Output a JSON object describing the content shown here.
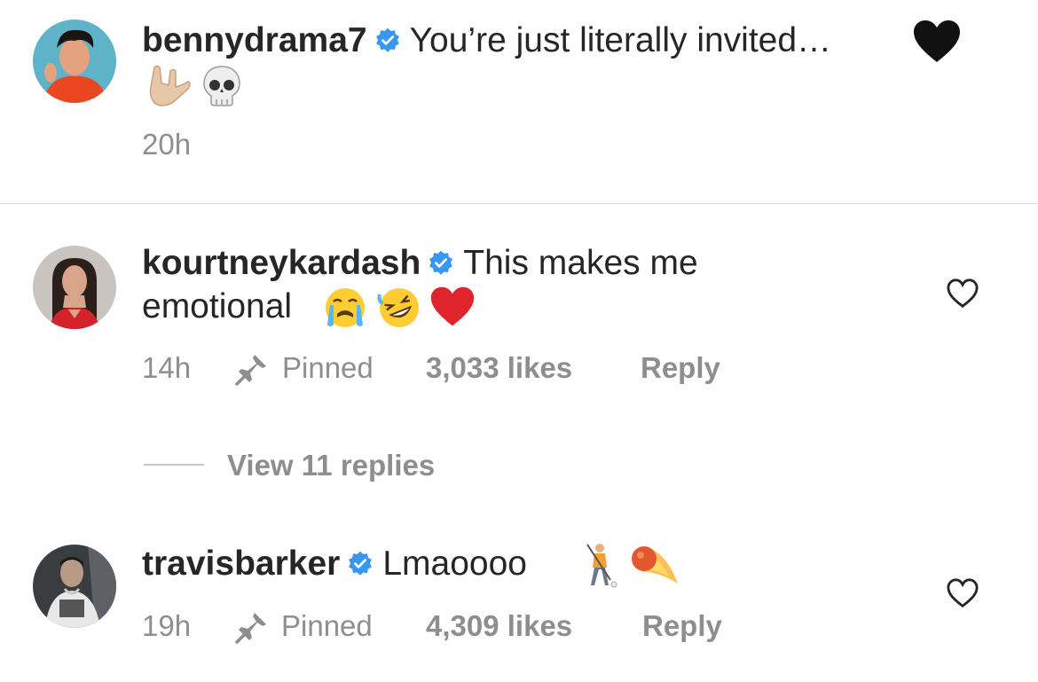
{
  "comments": [
    {
      "username": "bennydrama7",
      "text": "You’re just literally invited…",
      "time": "20h"
    },
    {
      "username": "kourtneykardash",
      "text_line1": "This makes me",
      "text_line2": "emotional",
      "time": "14h",
      "pinned_label": "Pinned",
      "likes": "3,033 likes",
      "reply_label": "Reply"
    },
    {
      "username": "travisbarker",
      "text": "Lmaoooo",
      "time": "19h",
      "pinned_label": "Pinned",
      "likes": "4,309 likes",
      "reply_label": "Reply"
    }
  ],
  "view_replies": "View 11 replies",
  "colors": {
    "text": "#262626",
    "secondary": "#8e8e8e",
    "verified": "#3897f0",
    "divider": "#dbdbdb"
  },
  "icons": [
    "verified-badge-icon",
    "pin-icon",
    "heart-outline-icon",
    "black-heart-emoji",
    "rock-on-hand-emoji",
    "skull-emoji",
    "crying-face-emoji",
    "rolling-laughing-emoji",
    "red-heart-emoji",
    "golfer-emoji",
    "comet-emoji"
  ]
}
